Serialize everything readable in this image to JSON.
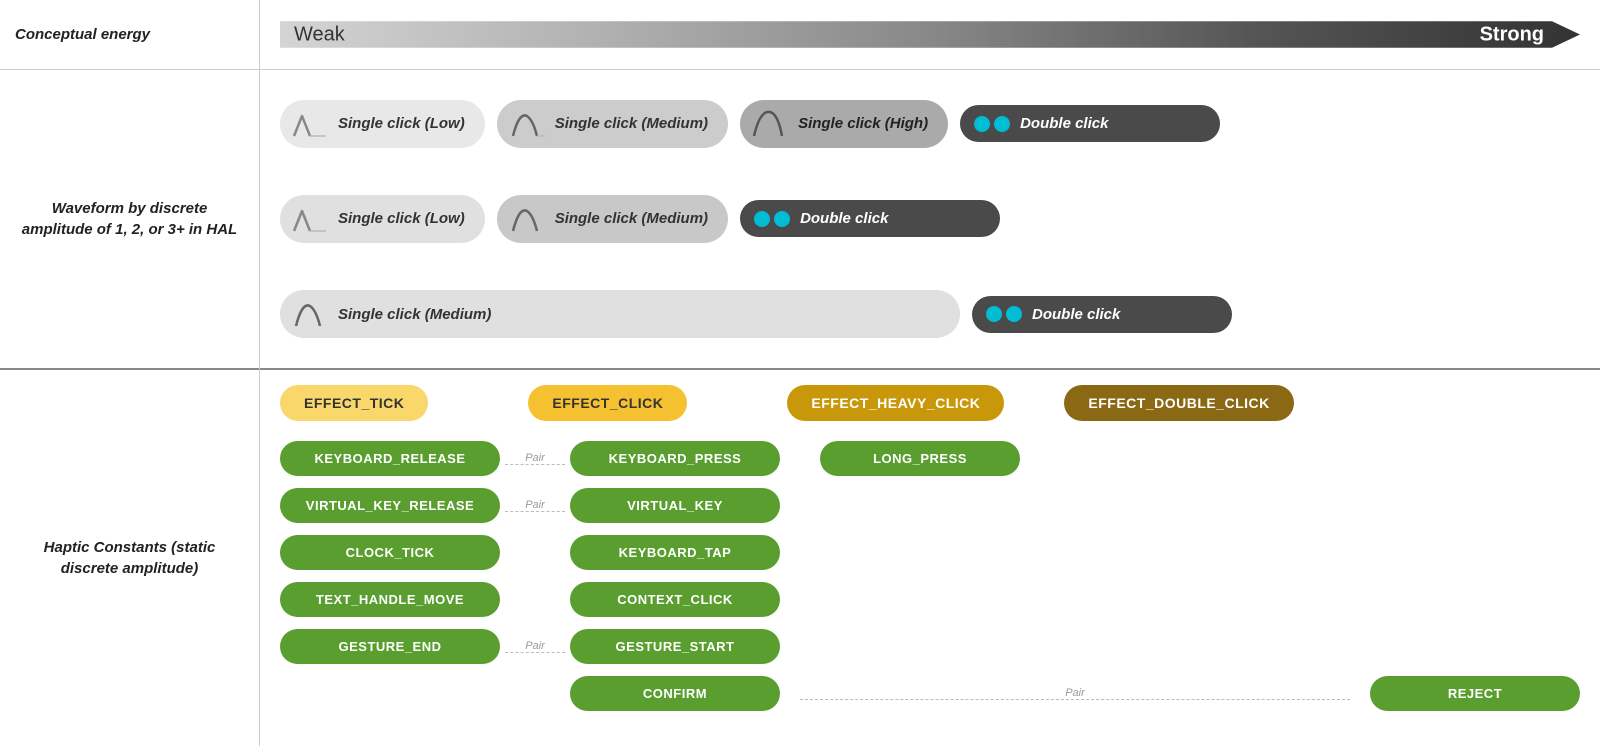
{
  "labels": {
    "conceptual_energy": "Conceptual energy",
    "weak": "Weak",
    "strong": "Strong",
    "waveform_label": "Waveform by discrete amplitude of 1, 2, or 3+ in HAL",
    "haptic_label": "Haptic Constants (static discrete amplitude)"
  },
  "waveform_rows": [
    {
      "items": [
        {
          "type": "low",
          "label": "Single click (Low)"
        },
        {
          "type": "medium",
          "label": "Single click (Medium)"
        },
        {
          "type": "high",
          "label": "Single click (High)"
        },
        {
          "type": "double",
          "label": "Double click"
        }
      ]
    },
    {
      "items": [
        {
          "type": "low",
          "label": "Single click (Low)"
        },
        {
          "type": "medium",
          "label": "Single click (Medium)"
        },
        {
          "type": "double",
          "label": "Double click"
        }
      ]
    },
    {
      "items": [
        {
          "type": "medium",
          "label": "Single click (Medium)"
        },
        {
          "type": "double",
          "label": "Double click"
        }
      ]
    }
  ],
  "effects": [
    {
      "label": "EFFECT_TICK",
      "color": "light-yellow"
    },
    {
      "label": "EFFECT_CLICK",
      "color": "mid-yellow"
    },
    {
      "label": "EFFECT_HEAVY_CLICK",
      "color": "dark-yellow"
    },
    {
      "label": "EFFECT_DOUBLE_CLICK",
      "color": "orange-dark"
    }
  ],
  "haptic_constants": {
    "col1": [
      {
        "label": "KEYBOARD_RELEASE",
        "pair": true
      },
      {
        "label": "VIRTUAL_KEY_RELEASE",
        "pair": true
      },
      {
        "label": "CLOCK_TICK"
      },
      {
        "label": "TEXT_HANDLE_MOVE"
      },
      {
        "label": "GESTURE_END",
        "pair": true
      }
    ],
    "col2": [
      {
        "label": "KEYBOARD_PRESS"
      },
      {
        "label": "VIRTUAL_KEY"
      },
      {
        "label": "KEYBOARD_TAP"
      },
      {
        "label": "CONTEXT_CLICK"
      },
      {
        "label": "GESTURE_START"
      },
      {
        "label": "CONFIRM"
      }
    ],
    "col3": [
      {
        "label": "LONG_PRESS"
      }
    ],
    "col4": [
      {
        "label": "REJECT"
      }
    ]
  },
  "pair_label": "Pair"
}
